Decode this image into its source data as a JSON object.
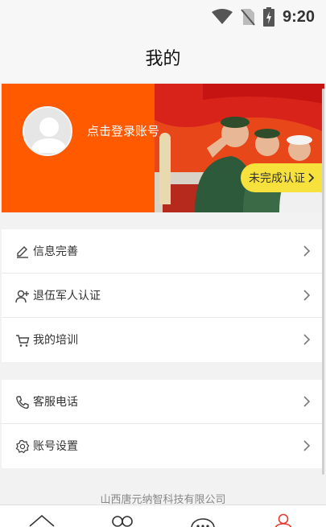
{
  "status_bar": {
    "time": "9:20",
    "icons": [
      "wifi-icon",
      "no-sim-icon",
      "battery-charging-icon"
    ]
  },
  "header": {
    "title": "我的"
  },
  "profile": {
    "login_text": "点击登录账号",
    "cert_button": "未完成认证"
  },
  "menu_group_1": [
    {
      "label": "信息完善",
      "icon": "pencil-icon"
    },
    {
      "label": "退伍军人认证",
      "icon": "user-plus-icon"
    },
    {
      "label": "我的培训",
      "icon": "cart-icon"
    }
  ],
  "menu_group_2": [
    {
      "label": "客服电话",
      "icon": "phone-icon"
    },
    {
      "label": "账号设置",
      "icon": "settings-icon"
    }
  ],
  "footer": {
    "company": "山西唐元纳智科技有限公司"
  },
  "tabbar": {
    "tabs": [
      "home-tab-icon",
      "discover-tab-icon",
      "message-tab-icon",
      "profile-tab-icon"
    ],
    "active_color": "#e53935"
  },
  "colors": {
    "banner": "#ff5a00",
    "cert_button": "#f7e23d"
  }
}
